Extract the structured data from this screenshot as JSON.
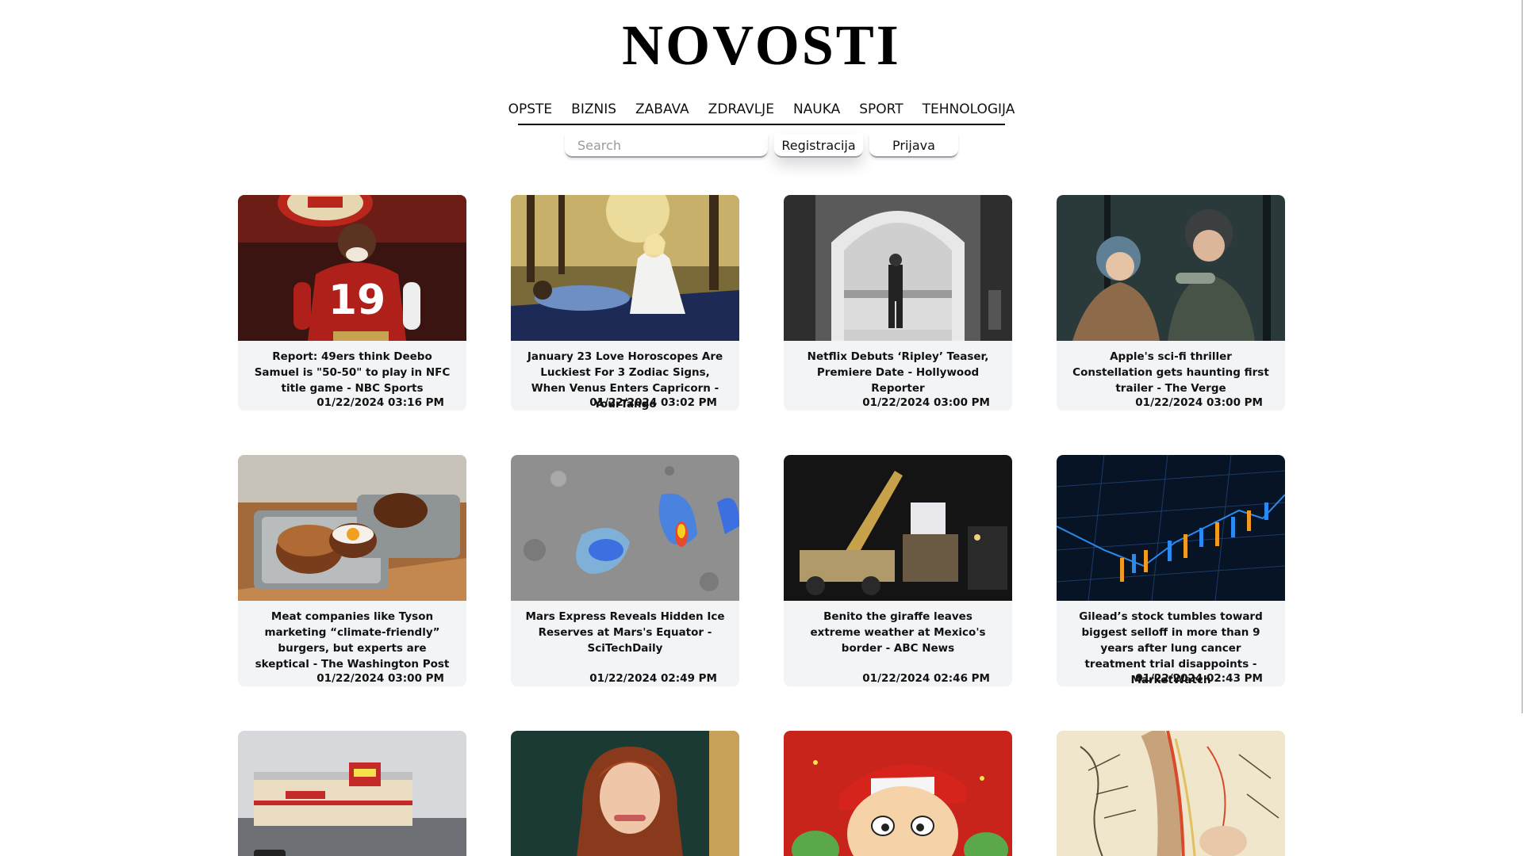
{
  "site": {
    "title": "NOVOSTI"
  },
  "nav": {
    "items": [
      "OPSTE",
      "BIZNIS",
      "ZABAVA",
      "ZDRAVLJE",
      "NAUKA",
      "SPORT",
      "TEHNOLOGIJA"
    ]
  },
  "search": {
    "placeholder": "Search",
    "value": ""
  },
  "auth": {
    "register_label": "Registracija",
    "login_label": "Prijava"
  },
  "articles": [
    {
      "title": "Report: 49ers think Deebo Samuel is \"50-50\" to play in NFC title game - NBC Sports",
      "date": "01/22/2024 03:16 PM"
    },
    {
      "title": "January 23 Love Horoscopes Are Luckiest For 3 Zodiac Signs, When Venus Enters Capricorn - YourTango",
      "date": "01/22/2024 03:02 PM"
    },
    {
      "title": "Netflix Debuts ‘Ripley’ Teaser, Premiere Date - Hollywood Reporter",
      "date": "01/22/2024 03:00 PM"
    },
    {
      "title": "Apple's sci-fi thriller Constellation gets haunting first trailer - The Verge",
      "date": "01/22/2024 03:00 PM"
    },
    {
      "title": "Meat companies like Tyson marketing “climate-friendly” burgers, but experts are skeptical - The Washington Post",
      "date": "01/22/2024 03:00 PM"
    },
    {
      "title": "Mars Express Reveals Hidden Ice Reserves at Mars's Equator - SciTechDaily",
      "date": "01/22/2024 02:49 PM"
    },
    {
      "title": "Benito the giraffe leaves extreme weather at Mexico's border - ABC News",
      "date": "01/22/2024 02:46 PM"
    },
    {
      "title": "Gilead’s stock tumbles toward biggest selloff in more than 9 years after lung cancer treatment trial disappoints - MarketWatch",
      "date": "01/22/2024 02:43 PM"
    },
    {
      "title": "",
      "date": ""
    },
    {
      "title": "",
      "date": ""
    },
    {
      "title": "",
      "date": ""
    },
    {
      "title": "",
      "date": ""
    }
  ]
}
